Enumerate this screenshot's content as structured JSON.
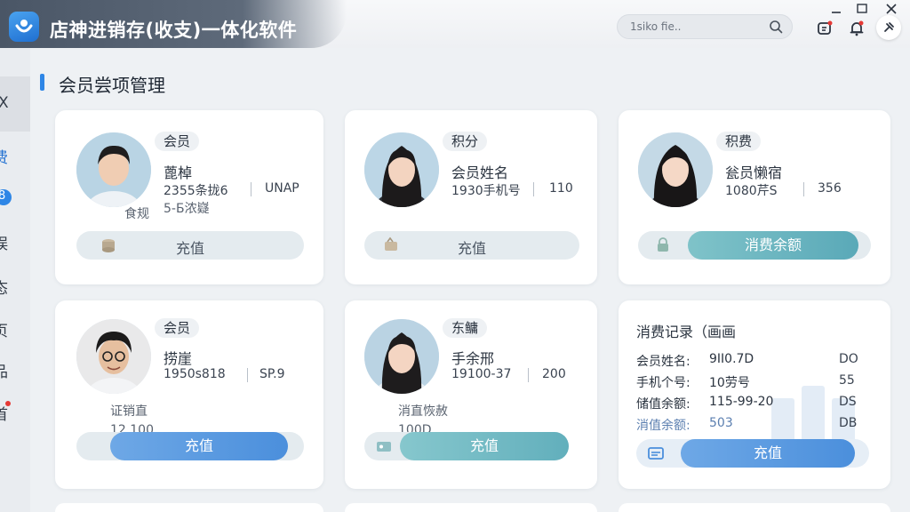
{
  "app": {
    "title": "店神进销存(收支)一体化软件",
    "search_placeholder": "1siko fie..",
    "accent": "#2e86e6"
  },
  "sidebar": {
    "items": [
      {
        "label": "X",
        "icon": "collapse-icon"
      },
      {
        "label": "费",
        "active": true
      },
      {
        "label": "8",
        "icon": "badge-icon"
      },
      {
        "label": "娱"
      },
      {
        "label": "态"
      },
      {
        "label": "页"
      },
      {
        "label": "品"
      },
      {
        "label": "首"
      }
    ]
  },
  "section": {
    "title": "会员尝项管理"
  },
  "cards": [
    {
      "tag": "会员",
      "name": "蓖棹",
      "meta_left": "2355条拢6",
      "meta_right": "UNAP",
      "sub1": "5-Б浓嶷",
      "sub2": "食规",
      "button": "充值",
      "button_style": "track"
    },
    {
      "tag": "积分",
      "name": "会员姓名",
      "meta_left": "1930手机号",
      "meta_right": "110",
      "button": "充值",
      "button_style": "track"
    },
    {
      "tag": "积费",
      "name": "瓮员懒宿",
      "meta_left": "1080芹S",
      "meta_right": "356",
      "button": "消费余额",
      "button_style": "teal"
    },
    {
      "tag": "会员",
      "name": "捞崖",
      "meta_left": "1950s818",
      "meta_right": "SP.9",
      "sub1": "证销直",
      "sub2": "12.100",
      "button": "充值",
      "button_style": "blue"
    },
    {
      "tag": "东鳙",
      "name": "手余邢",
      "meta_left": "19100-37",
      "meta_right": "200",
      "sub1": "消直恢赦",
      "sub2": "100D",
      "button": "充值",
      "button_style": "teal"
    }
  ],
  "record": {
    "title": "消费记录（画画",
    "rows": [
      {
        "key": "会员姓名:",
        "value": "9II0.7D",
        "right": "DO"
      },
      {
        "key": "手机个号:",
        "value": "10劳号",
        "right": "55"
      },
      {
        "key": "储值余额:",
        "value": "115-99-20",
        "right": "DS"
      },
      {
        "key": "消值余额:",
        "value": "503",
        "right": "DB"
      }
    ],
    "button": "充值"
  }
}
